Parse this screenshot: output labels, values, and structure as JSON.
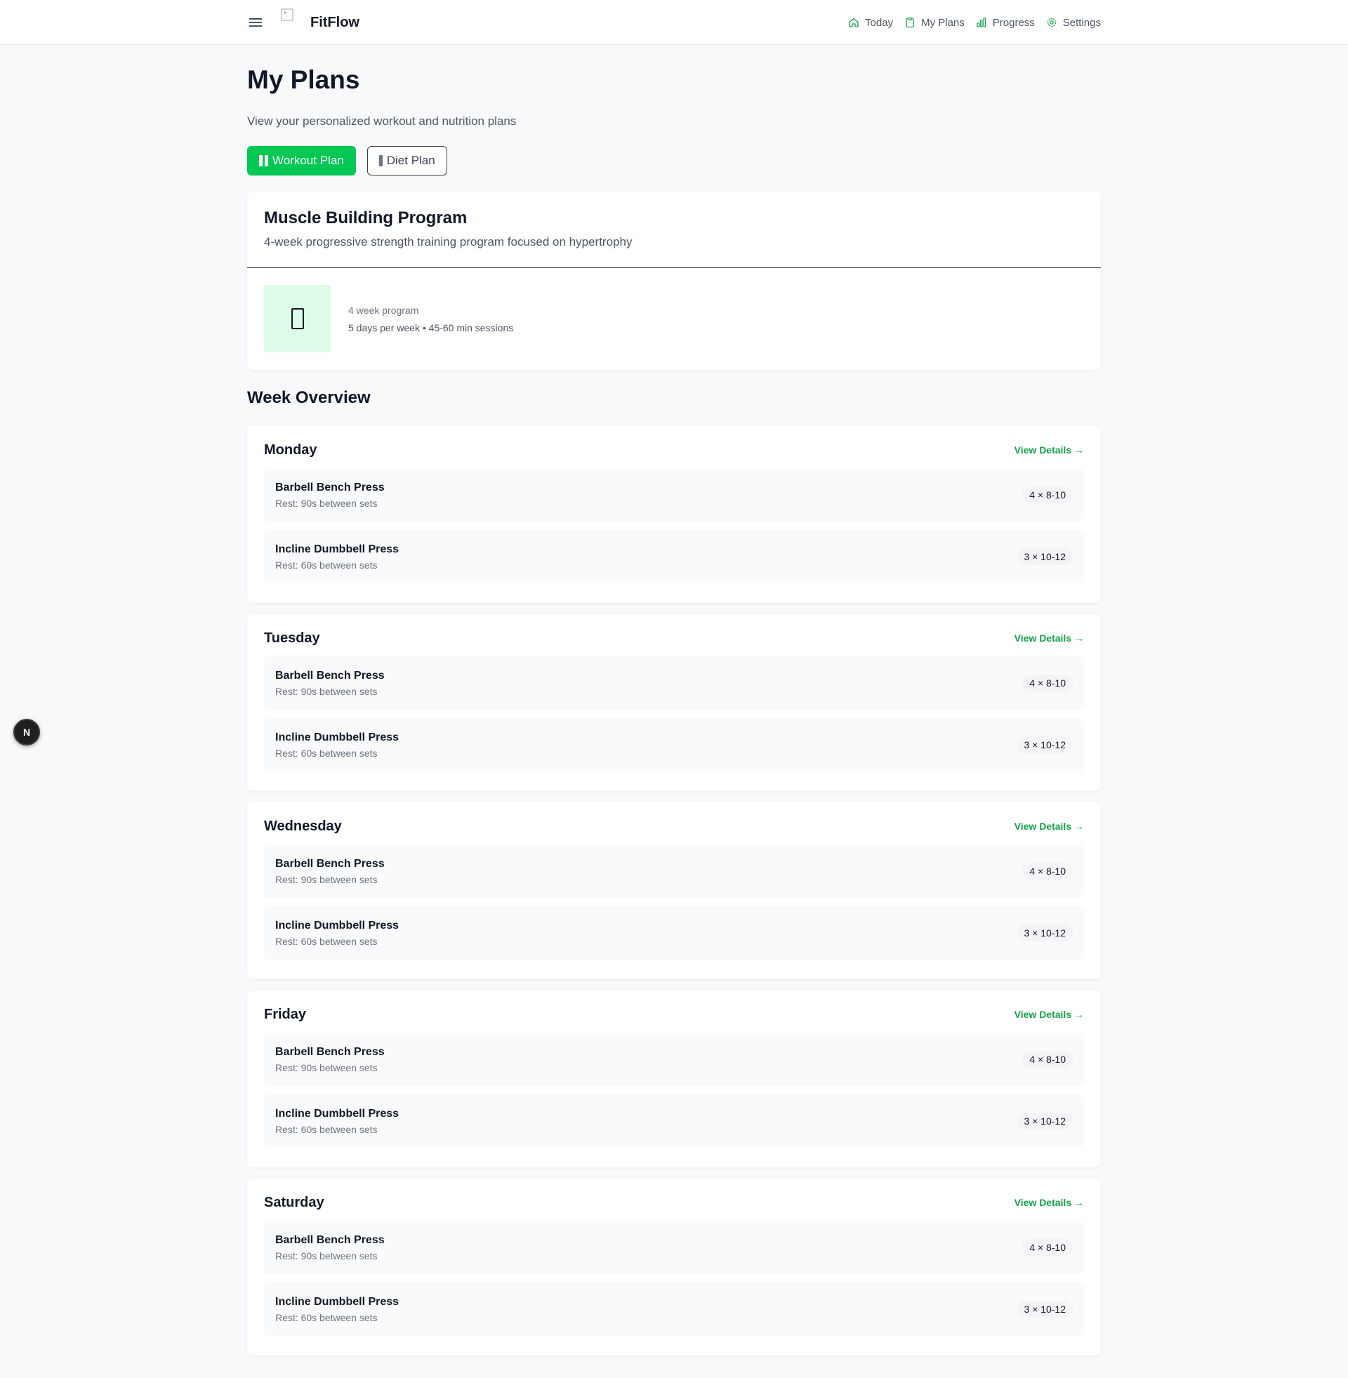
{
  "app": {
    "name": "FitFlow",
    "accent_color": "#00c853"
  },
  "nav": {
    "items": [
      {
        "label": "Today",
        "icon": "home-icon"
      },
      {
        "label": "My Plans",
        "icon": "clipboard-icon"
      },
      {
        "label": "Progress",
        "icon": "bar-chart-icon"
      },
      {
        "label": "Settings",
        "icon": "gear-icon"
      }
    ]
  },
  "page": {
    "title": "My Plans",
    "subtitle": "View your personalized workout and nutrition plans"
  },
  "tabs": [
    {
      "label": "Workout Plan",
      "active": true
    },
    {
      "label": "Diet Plan",
      "active": false
    }
  ],
  "program": {
    "title": "Muscle Building Program",
    "description": "4-week progressive strength training program focused on hypertrophy",
    "weeks": "4 week program",
    "schedule": "5 days per week • 45-60 min sessions"
  },
  "week_overview": {
    "title": "Week Overview",
    "view_label": "View Details →",
    "days": [
      {
        "name": "Monday",
        "exercises": [
          {
            "name": "Barbell Bench Press",
            "rest": "Rest: 90s between sets",
            "sets": "4 × 8-10"
          },
          {
            "name": "Incline Dumbbell Press",
            "rest": "Rest: 60s between sets",
            "sets": "3 × 10-12"
          }
        ]
      },
      {
        "name": "Tuesday",
        "exercises": [
          {
            "name": "Barbell Bench Press",
            "rest": "Rest: 90s between sets",
            "sets": "4 × 8-10"
          },
          {
            "name": "Incline Dumbbell Press",
            "rest": "Rest: 60s between sets",
            "sets": "3 × 10-12"
          }
        ]
      },
      {
        "name": "Wednesday",
        "exercises": [
          {
            "name": "Barbell Bench Press",
            "rest": "Rest: 90s between sets",
            "sets": "4 × 8-10"
          },
          {
            "name": "Incline Dumbbell Press",
            "rest": "Rest: 60s between sets",
            "sets": "3 × 10-12"
          }
        ]
      },
      {
        "name": "Friday",
        "exercises": [
          {
            "name": "Barbell Bench Press",
            "rest": "Rest: 90s between sets",
            "sets": "4 × 8-10"
          },
          {
            "name": "Incline Dumbbell Press",
            "rest": "Rest: 60s between sets",
            "sets": "3 × 10-12"
          }
        ]
      },
      {
        "name": "Saturday",
        "exercises": [
          {
            "name": "Barbell Bench Press",
            "rest": "Rest: 90s between sets",
            "sets": "4 × 8-10"
          },
          {
            "name": "Incline Dumbbell Press",
            "rest": "Rest: 60s between sets",
            "sets": "3 × 10-12"
          }
        ]
      }
    ]
  },
  "floating_badge": {
    "label": "N"
  }
}
